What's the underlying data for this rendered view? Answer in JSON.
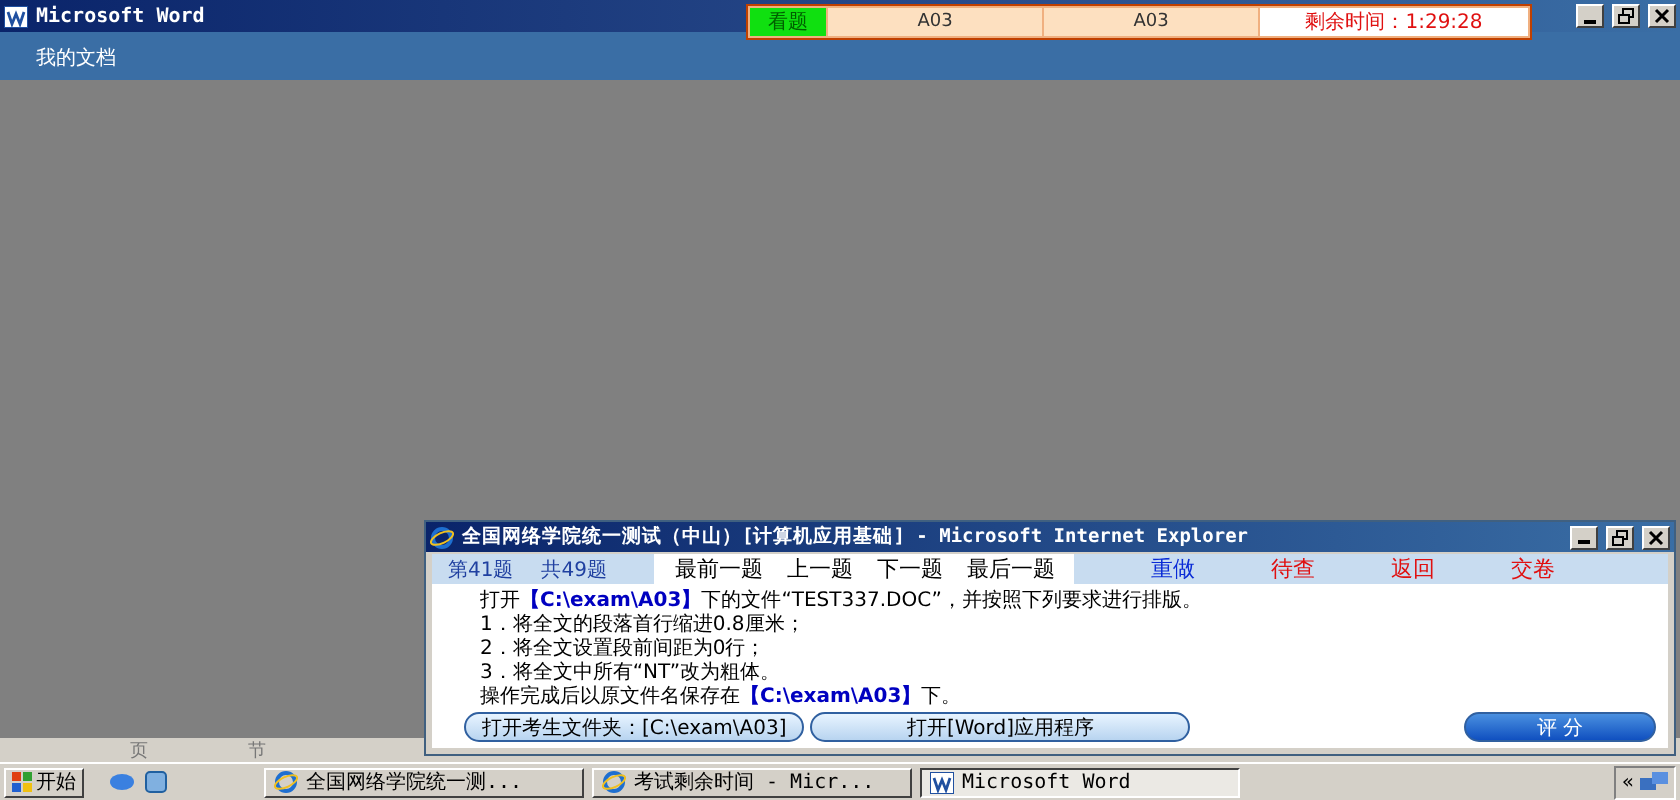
{
  "word_window": {
    "title": "Microsoft Word",
    "desktop_icon_label": "我的文档",
    "status_bar": [
      "页",
      "节"
    ]
  },
  "exam_bar": {
    "label": "看题",
    "fields": [
      "A03",
      "A03"
    ],
    "timer": "剩余时间：1:29:28"
  },
  "ie_window": {
    "title": "全国网络学院统一测试（中山）[计算机应用基础] - Microsoft Internet Explorer",
    "current": "第41题",
    "total": "共49题",
    "links": [
      "最前一题",
      "上一题",
      "下一题",
      "最后一题"
    ],
    "actions": [
      {
        "label": "重做",
        "color": "#0a2bd6"
      },
      {
        "label": "待查",
        "color": "#e01010"
      },
      {
        "label": "返回",
        "color": "#e01010"
      },
      {
        "label": "交卷",
        "color": "#e01010"
      }
    ],
    "instructions": [
      "打开**【C:\\exam\\A03】**下的文件“TEST337.DOC”，并按照下列要求进行排版。",
      "1．将全文的段落首行缩进0.8厘米；",
      "2．将全文设置段前间距为0行；",
      "3．将全文中所有“NT”改为粗体。",
      "操作完成后以原文件名保存在**【C:\\exam\\A03】**下。"
    ],
    "buttons": [
      {
        "label": "打开考生文件夹：[C:\\exam\\A03]",
        "kind": "plain"
      },
      {
        "label": "打开[Word]应用程序",
        "kind": "plain"
      },
      {
        "label": "评 分",
        "kind": "primary"
      }
    ]
  },
  "taskbar": {
    "start": "开始",
    "tasks": [
      {
        "label": "全国网络学院统一测...",
        "selected": false
      },
      {
        "label": "考试剩余时间 - Micr...",
        "selected": false
      },
      {
        "label": "Microsoft Word",
        "selected": true
      }
    ],
    "tray": "«"
  }
}
